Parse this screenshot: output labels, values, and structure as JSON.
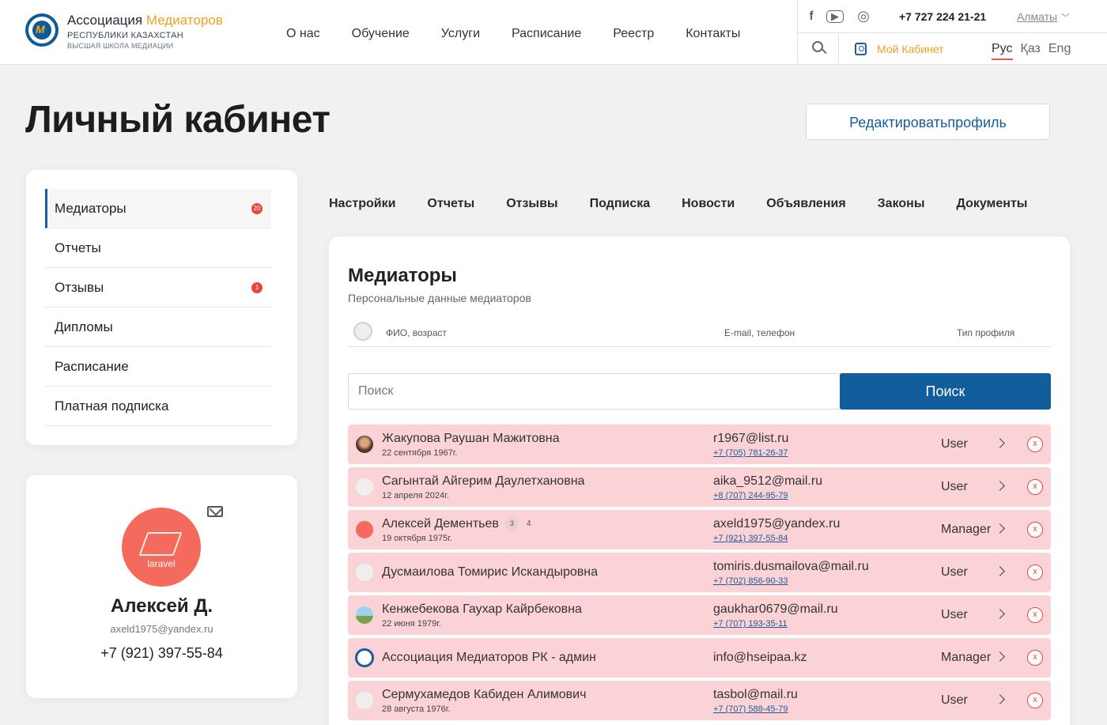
{
  "header": {
    "logo": {
      "title_main": "Ассоциация",
      "title_accent": "Медиаторов",
      "subtitle": "РЕСПУБЛИКИ КАЗАХСТАН",
      "tagline": "ВЫСШАЯ ШКОЛА МЕДИАЦИИ",
      "mark": "M"
    },
    "nav": [
      "О нас",
      "Обучение",
      "Услуги",
      "Расписание",
      "Реестр",
      "Контакты"
    ],
    "social": [
      {
        "name": "facebook-icon",
        "glyph": "f"
      },
      {
        "name": "youtube-icon",
        "glyph": "▶"
      },
      {
        "name": "instagram-icon",
        "glyph": "◎"
      }
    ],
    "phone": "+7 727 224 21-21",
    "city": "Алматы",
    "cabinet": "Мой Кабинет",
    "langs": [
      {
        "label": "Рус",
        "active": true
      },
      {
        "label": "Қаз",
        "active": false
      },
      {
        "label": "Eng",
        "active": false
      }
    ]
  },
  "page": {
    "title": "Личный кабинет",
    "edit_button": "Редактироватьпрофиль"
  },
  "sidebar": {
    "items": [
      {
        "label": "Медиаторы",
        "badge": "20",
        "active": true
      },
      {
        "label": "Отчеты",
        "badge": "",
        "active": false
      },
      {
        "label": "Отзывы",
        "badge": "1",
        "active": false
      },
      {
        "label": "Дипломы",
        "badge": "",
        "active": false
      },
      {
        "label": "Расписание",
        "badge": "",
        "active": false
      },
      {
        "label": "Платная подписка",
        "badge": "",
        "active": false
      }
    ]
  },
  "profile": {
    "avatar_text": "laravel",
    "name": "Алексей Д.",
    "email": "axeld1975@yandex.ru",
    "phone": "+7 (921) 397-55-84"
  },
  "tabs": [
    "Настройки",
    "Отчеты",
    "Отзывы",
    "Подписка",
    "Новости",
    "Объявления",
    "Законы",
    "Документы"
  ],
  "main": {
    "title": "Медиаторы",
    "subtitle": "Персональные данные медиаторов",
    "columns": {
      "fio": "ФИО, возраст",
      "contact": "E-mail, телефон",
      "type": "Тип профиля"
    },
    "search_placeholder": "Поиск",
    "search_button": "Поиск",
    "rows": [
      {
        "name": "Жакупова Раушан Мажитовна",
        "date": "22 сентября 1967г.",
        "email": "r1967@list.ru",
        "phone": "+7 (705) 781-26-37",
        "type": "User",
        "avatar": "photo-brown",
        "count1": "",
        "count2": ""
      },
      {
        "name": "Сагынтай Айгерим Даулетхановна",
        "date": "12 апреля 2024г.",
        "email": "aika_9512@mail.ru",
        "phone": "+8 (707) 244-95-79",
        "type": "User",
        "avatar": "empty",
        "count1": "",
        "count2": ""
      },
      {
        "name": "Алексей Дементьев",
        "date": "19 октября 1975г.",
        "email": "axeld1975@yandex.ru",
        "phone": "+7 (921) 397-55-84",
        "type": "Manager",
        "avatar": "laravel",
        "count1": "3",
        "count2": "4"
      },
      {
        "name": "Дусмаилова Томирис Искандыровна",
        "date": "",
        "email": "tomiris.dusmailova@mail.ru",
        "phone": "+7 (702) 856-90-33",
        "type": "User",
        "avatar": "empty",
        "count1": "",
        "count2": ""
      },
      {
        "name": "Кенжебекова Гаухар Кайрбековна",
        "date": "22 июня 1979г.",
        "email": "gaukhar0679@mail.ru",
        "phone": "+7 (707) 193-35-11",
        "type": "User",
        "avatar": "photo-sky",
        "count1": "",
        "count2": ""
      },
      {
        "name": "Ассоциация Медиаторов РК - админ",
        "date": "",
        "email": "info@hseipaa.kz",
        "phone": "",
        "type": "Manager",
        "avatar": "logo",
        "count1": "",
        "count2": ""
      },
      {
        "name": "Сермухамедов Кабиден Алимович",
        "date": "28 августа 1976г.",
        "email": "tasbol@mail.ru",
        "phone": "+7 (707) 588-45-79",
        "type": "User",
        "avatar": "empty",
        "count1": "",
        "count2": ""
      }
    ],
    "delete_glyph": "x"
  }
}
